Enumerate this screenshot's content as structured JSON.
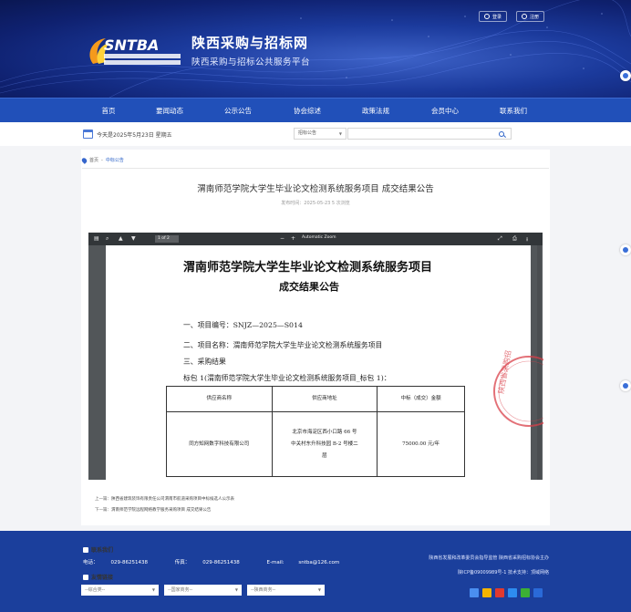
{
  "header": {
    "site_title": "陕西采购与招标网",
    "site_subtitle": "陕西采购与招标公共服务平台",
    "logo_text": "SNTBA",
    "login_buttons": [
      {
        "label": "登录",
        "icon": "user-icon"
      },
      {
        "label": "注册",
        "icon": "register-icon"
      }
    ]
  },
  "nav": {
    "items": [
      "首页",
      "要闻动态",
      "公示公告",
      "协会综述",
      "政策法规",
      "会员中心",
      "联系我们"
    ]
  },
  "strip": {
    "date_text": "今天是2025年5月23日 星期五",
    "search_category": "招标公告",
    "search_placeholder": ""
  },
  "breadcrumb": {
    "home": "首页",
    "separator": "-",
    "current": "中标公告"
  },
  "article": {
    "title": "渭南师范学院大学生毕业论文检测系统服务项目 成交结果公告",
    "meta": "发布时间：2025-05-23    5 次浏览"
  },
  "viewer": {
    "page_indicator": "1  of 2",
    "zoom_label": "Automatic Zoom",
    "toolbar_icons": [
      "sidebar-toggle-icon",
      "search-icon",
      "prev-page-icon",
      "next-page-icon",
      "zoom-out-icon",
      "zoom-in-icon",
      "fullscreen-icon",
      "print-icon",
      "download-icon"
    ]
  },
  "pdf": {
    "title_line1": "渭南师范学院大学生毕业论文检测系统服务项目",
    "title_line2": "成交结果公告",
    "lines": [
      "一、项目编号：SNJZ—2025—S014",
      "二、项目名称：渭南师范学院大学生毕业论文检测系统服务项目",
      "三、采购结果",
      "标包 1(渭南师范学院大学生毕业论文检测系统服务项目_标包 1)："
    ],
    "table": {
      "headers": [
        "供应商名称",
        "供应商地址",
        "中标（成交）金额"
      ],
      "row": {
        "name": "同方知网数字科技有限公司",
        "address": [
          "北京市海淀区西小口路 66 号",
          "中关村东升科技园 B-2 号楼二",
          "层"
        ],
        "amount": "75000.00 元/年"
      }
    },
    "seal_text": "陕西省采购招标"
  },
  "prevnext": {
    "prev_label": "上一篇：",
    "prev_title": "陕西省建筑装饰有限责任公司渭南市航道采购项目中标候选人公示表",
    "next_label": "下一篇：",
    "next_title": "渭南师范学院远程网络教学服务采购项目 成交结果公告"
  },
  "footer": {
    "contact_heading": "联系我们",
    "phone_label": "电话：",
    "phone": "029-86251438",
    "fax_label": "传真：",
    "fax": "029-86251438",
    "email_label": "E-mail:",
    "email": "sntba@126.com",
    "links_heading": "友情链接",
    "link_selects": [
      "--综合类--",
      "--国家商务--",
      "--陕西商务--"
    ],
    "right_line1": "陕西省发展和改革委员会指导监管  陕西省采购招标协会主办",
    "right_line2": "陕ICP备09009989号-1  技术支持：顶域网络"
  },
  "colors": {
    "nav_bg": "#2150b9",
    "footer_bg": "#1b3f9c",
    "accent": "#2d63c8"
  }
}
